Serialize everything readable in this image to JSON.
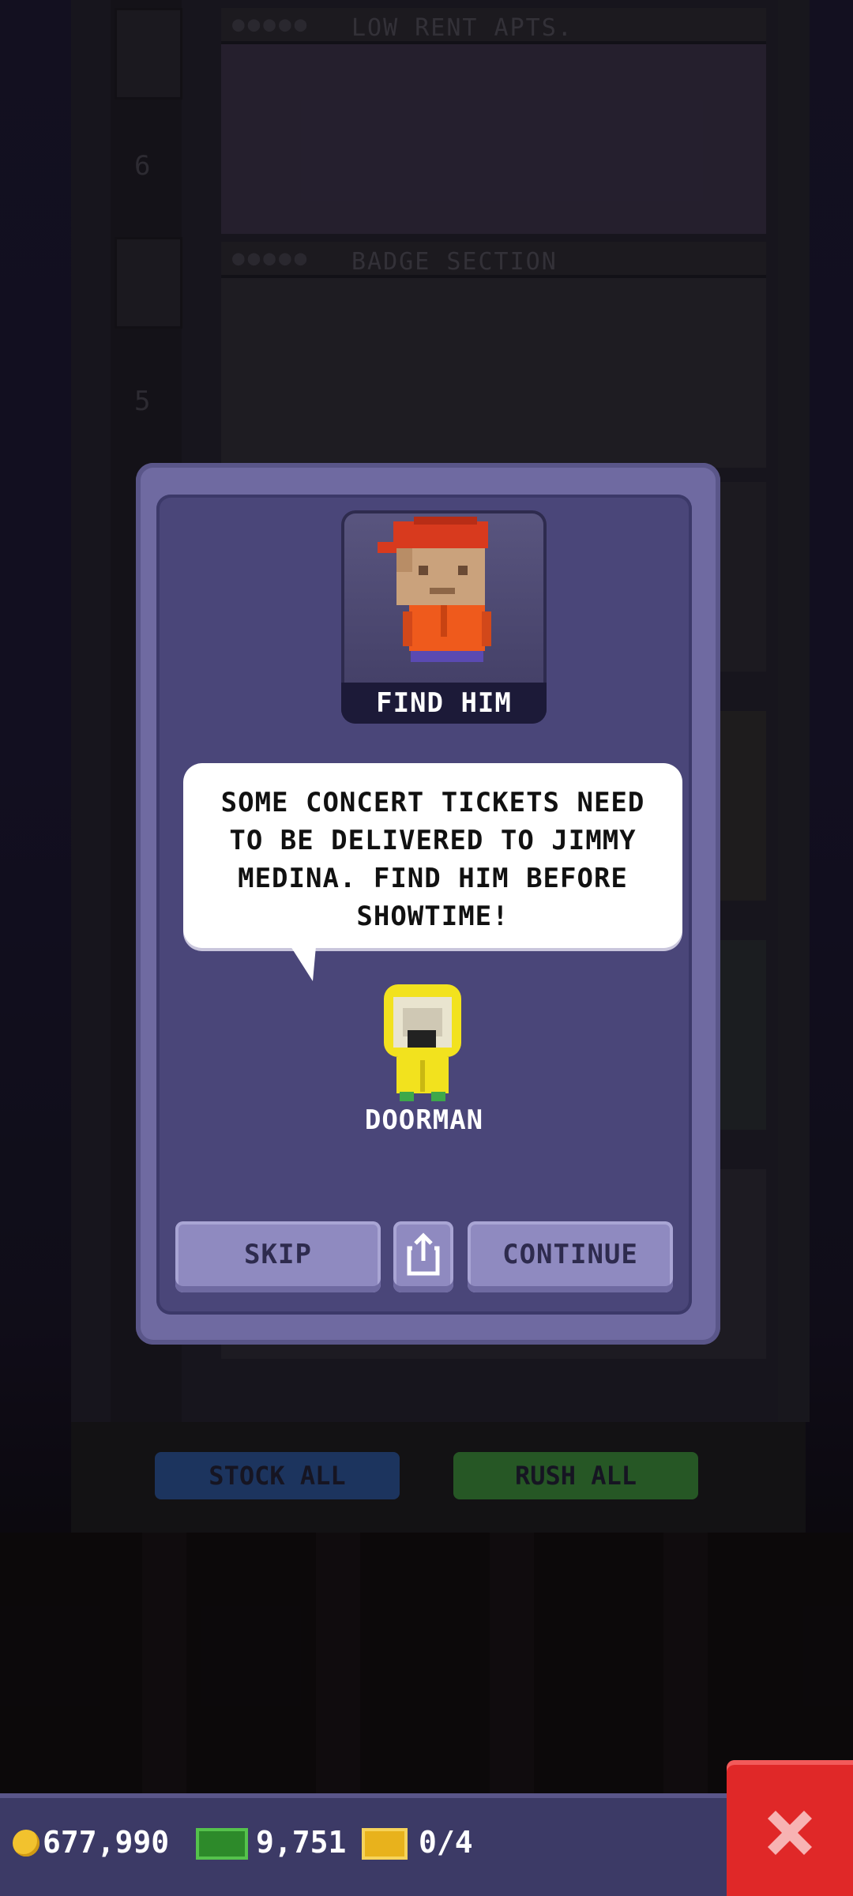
{
  "background": {
    "floors": [
      {
        "label": "LOW RENT APTS.",
        "number": "6"
      },
      {
        "label": "BADGE SECTION",
        "number": "5"
      }
    ],
    "lobby_buttons": {
      "stock_all": "STOCK ALL",
      "rush_all": "RUSH ALL"
    }
  },
  "dialog": {
    "portrait_caption": "FIND HIM",
    "message": "SOME CONCERT TICKETS NEED TO BE DELIVERED TO JIMMY MEDINA. FIND HIM BEFORE SHOWTIME!",
    "speaker": "DOORMAN",
    "buttons": {
      "skip": "SKIP",
      "continue": "CONTINUE"
    }
  },
  "hud": {
    "coins": "677,990",
    "bux": "9,751",
    "tickets": "0/4"
  },
  "colors": {
    "dialog_frame": "#6f6aa1",
    "dialog_body": "#4a4679",
    "button": "#8f8ac0",
    "close_button": "#e02828",
    "hud_bar": "#3c3a66"
  },
  "icons": {
    "share": "share-icon",
    "close": "close-icon",
    "coin": "coin-icon",
    "bux": "bux-icon",
    "ticket": "ticket-icon"
  }
}
